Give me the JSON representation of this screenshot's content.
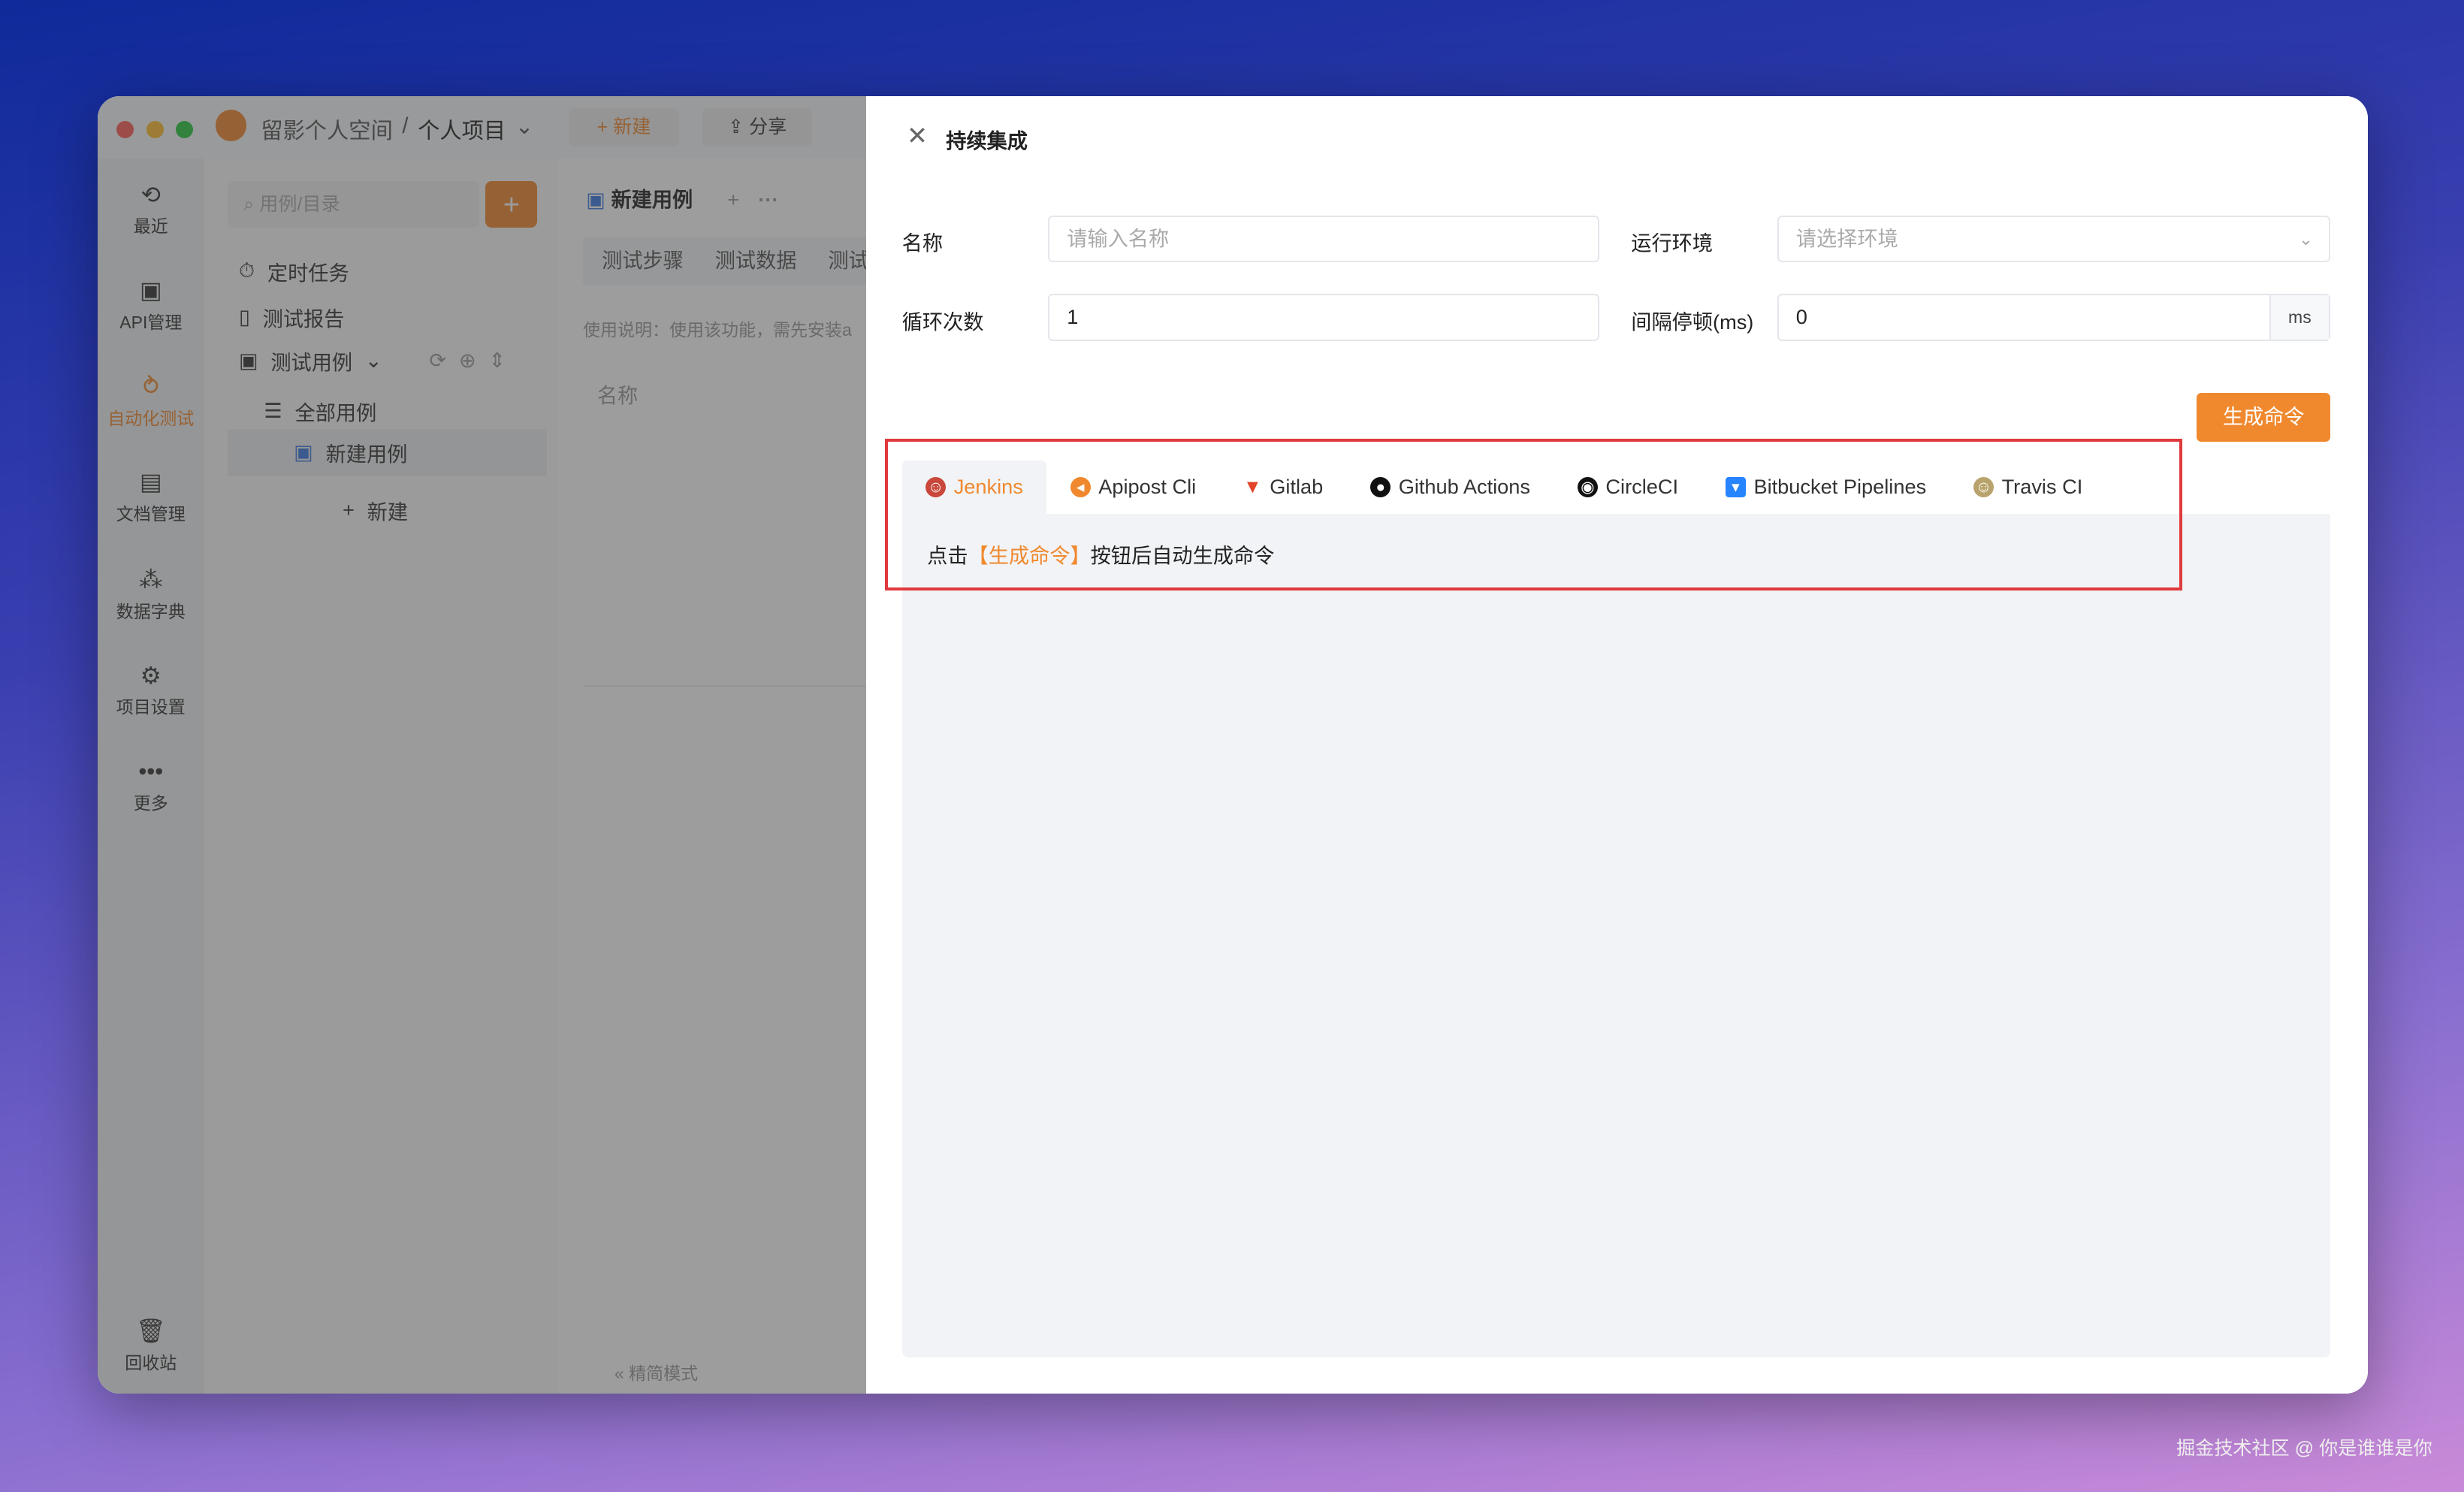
{
  "titlebar": {
    "workspace": "留影个人空间",
    "separator": "/",
    "project": "个人项目",
    "new_label": "新建",
    "share_label": "分享"
  },
  "rail": [
    {
      "label": "最近",
      "icon": "history-icon"
    },
    {
      "label": "API管理",
      "icon": "api-icon"
    },
    {
      "label": "自动化测试",
      "icon": "automation-icon",
      "active": true
    },
    {
      "label": "文档管理",
      "icon": "doc-icon"
    },
    {
      "label": "数据字典",
      "icon": "dictionary-icon"
    },
    {
      "label": "项目设置",
      "icon": "settings-icon"
    },
    {
      "label": "更多",
      "icon": "more-icon"
    }
  ],
  "rail_bottom": {
    "label": "回收站",
    "icon": "trash-icon"
  },
  "tree": {
    "search_placeholder": "用例/目录",
    "items": [
      "定时任务",
      "测试报告",
      "测试用例",
      "全部用例",
      "新建用例"
    ],
    "new_label": "新建"
  },
  "content": {
    "tab_title": "新建用例",
    "subtabs": [
      "测试步骤",
      "测试数据",
      "测试"
    ],
    "hint": "使用说明：使用该功能，需先安装a",
    "col_name": "名称",
    "footer": "精简模式"
  },
  "drawer": {
    "title": "持续集成",
    "form": {
      "name_label": "名称",
      "name_placeholder": "请输入名称",
      "env_label": "运行环境",
      "env_placeholder": "请选择环境",
      "loop_label": "循环次数",
      "loop_value": "1",
      "interval_label": "间隔停顿(ms)",
      "interval_value": "0",
      "interval_unit": "ms"
    },
    "generate_label": "生成命令",
    "tabs": [
      {
        "label": "Jenkins",
        "icon": "jenkins-icon",
        "active": true
      },
      {
        "label": "Apipost Cli",
        "icon": "apipost-icon"
      },
      {
        "label": "Gitlab",
        "icon": "gitlab-icon"
      },
      {
        "label": "Github Actions",
        "icon": "github-icon"
      },
      {
        "label": "CircleCI",
        "icon": "circleci-icon"
      },
      {
        "label": "Bitbucket Pipelines",
        "icon": "bitbucket-icon"
      },
      {
        "label": "Travis CI",
        "icon": "travis-icon"
      }
    ],
    "hint_prefix": "点击",
    "hint_highlight": "【生成命令】",
    "hint_suffix": "按钮后自动生成命令"
  },
  "watermark": "掘金技术社区 @ 你是谁谁是你",
  "colors": {
    "accent": "#f0892e",
    "highlight_box": "#e03a3e"
  }
}
